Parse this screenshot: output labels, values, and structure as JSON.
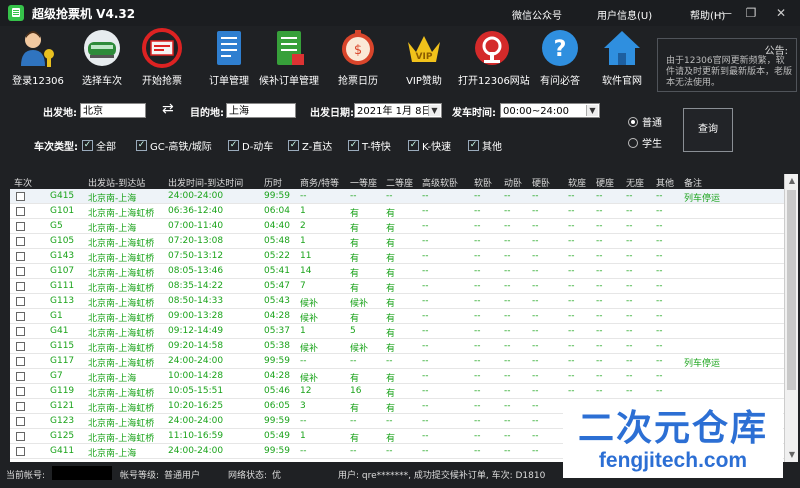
{
  "titlebar": {
    "title": "超级抢票机 V4.32",
    "menu": [
      "微信公众号",
      "用户信息(U)",
      "帮助(H)"
    ],
    "win_buttons": [
      "—",
      "❐",
      "✕"
    ]
  },
  "toolbar": {
    "items": [
      {
        "label": "登录12306",
        "icon": "user-key-icon"
      },
      {
        "label": "选择车次",
        "icon": "train-icon"
      },
      {
        "label": "开始抢票",
        "icon": "ticket-icon"
      },
      {
        "label": "订单管理",
        "icon": "order-list-icon"
      },
      {
        "label": "候补订单管理",
        "icon": "waitlist-icon"
      },
      {
        "label": "抢票日历",
        "icon": "clock-money-icon"
      },
      {
        "label": "VIP赞助",
        "icon": "vip-crown-icon"
      },
      {
        "label": "打开12306网站",
        "icon": "railway-logo-icon"
      },
      {
        "label": "有问必答",
        "icon": "help-icon"
      },
      {
        "label": "软件官网",
        "icon": "home-icon"
      }
    ],
    "notice_title": "公告:",
    "notice_body": "由于12306官网更新频繁，软件请及时更新到最新版本，老版本无法使用。"
  },
  "search": {
    "from_label": "出发地:",
    "from_value": "北京",
    "to_label": "目的地:",
    "to_value": "上海",
    "date_label": "出发日期:",
    "date_value": "2021年 1月 8日",
    "time_label": "发车时间:",
    "time_value": "00:00~24:00",
    "type_label": "车次类型:",
    "types": [
      "全部",
      "GC-高铁/城际",
      "D-动车",
      "Z-直达",
      "T-特快",
      "K-快速",
      "其他"
    ],
    "ticket_types": [
      "普通",
      "学生"
    ],
    "query_label": "查询"
  },
  "table": {
    "headers": [
      "车次",
      "出发站-到达站",
      "出发时间-到达时间",
      "历时",
      "商务/特等",
      "一等座",
      "二等座",
      "高级软卧",
      "软卧",
      "动卧",
      "硬卧",
      "软座",
      "硬座",
      "无座",
      "其他",
      "备注"
    ],
    "rows": [
      [
        "G415",
        "北京南-上海",
        "24:00-24:00",
        "99:59",
        "--",
        "--",
        "--",
        "--",
        "--",
        "--",
        "--",
        "--",
        "--",
        "--",
        "--",
        "列车停运"
      ],
      [
        "G101",
        "北京南-上海虹桥",
        "06:36-12:40",
        "06:04",
        "1",
        "有",
        "有",
        "--",
        "--",
        "--",
        "--",
        "--",
        "--",
        "--",
        "--",
        ""
      ],
      [
        "G5",
        "北京南-上海",
        "07:00-11:40",
        "04:40",
        "2",
        "有",
        "有",
        "--",
        "--",
        "--",
        "--",
        "--",
        "--",
        "--",
        "--",
        ""
      ],
      [
        "G105",
        "北京南-上海虹桥",
        "07:20-13:08",
        "05:48",
        "1",
        "有",
        "有",
        "--",
        "--",
        "--",
        "--",
        "--",
        "--",
        "--",
        "--",
        ""
      ],
      [
        "G143",
        "北京南-上海虹桥",
        "07:50-13:12",
        "05:22",
        "11",
        "有",
        "有",
        "--",
        "--",
        "--",
        "--",
        "--",
        "--",
        "--",
        "--",
        ""
      ],
      [
        "G107",
        "北京南-上海虹桥",
        "08:05-13:46",
        "05:41",
        "14",
        "有",
        "有",
        "--",
        "--",
        "--",
        "--",
        "--",
        "--",
        "--",
        "--",
        ""
      ],
      [
        "G111",
        "北京南-上海虹桥",
        "08:35-14:22",
        "05:47",
        "7",
        "有",
        "有",
        "--",
        "--",
        "--",
        "--",
        "--",
        "--",
        "--",
        "--",
        ""
      ],
      [
        "G113",
        "北京南-上海虹桥",
        "08:50-14:33",
        "05:43",
        "候补",
        "候补",
        "有",
        "--",
        "--",
        "--",
        "--",
        "--",
        "--",
        "--",
        "--",
        ""
      ],
      [
        "G1",
        "北京南-上海虹桥",
        "09:00-13:28",
        "04:28",
        "候补",
        "有",
        "有",
        "--",
        "--",
        "--",
        "--",
        "--",
        "--",
        "--",
        "--",
        ""
      ],
      [
        "G41",
        "北京南-上海虹桥",
        "09:12-14:49",
        "05:37",
        "1",
        "5",
        "有",
        "--",
        "--",
        "--",
        "--",
        "--",
        "--",
        "--",
        "--",
        ""
      ],
      [
        "G115",
        "北京南-上海虹桥",
        "09:20-14:58",
        "05:38",
        "候补",
        "候补",
        "有",
        "--",
        "--",
        "--",
        "--",
        "--",
        "--",
        "--",
        "--",
        ""
      ],
      [
        "G117",
        "北京南-上海虹桥",
        "24:00-24:00",
        "99:59",
        "--",
        "--",
        "--",
        "--",
        "--",
        "--",
        "--",
        "--",
        "--",
        "--",
        "--",
        "列车停运"
      ],
      [
        "G7",
        "北京南-上海",
        "10:00-14:28",
        "04:28",
        "候补",
        "有",
        "有",
        "--",
        "--",
        "--",
        "--",
        "--",
        "--",
        "--",
        "--",
        ""
      ],
      [
        "G119",
        "北京南-上海虹桥",
        "10:05-15:51",
        "05:46",
        "12",
        "16",
        "有",
        "--",
        "--",
        "--",
        "--",
        "--",
        "--",
        "--",
        "--",
        ""
      ],
      [
        "G121",
        "北京南-上海虹桥",
        "10:20-16:25",
        "06:05",
        "3",
        "有",
        "有",
        "--",
        "--",
        "--",
        "--",
        "--",
        "--",
        "--",
        "--",
        ""
      ],
      [
        "G123",
        "北京南-上海虹桥",
        "24:00-24:00",
        "99:59",
        "--",
        "--",
        "--",
        "--",
        "--",
        "--",
        "--",
        "--",
        "--",
        "--",
        "--",
        ""
      ],
      [
        "G125",
        "北京南-上海虹桥",
        "11:10-16:59",
        "05:49",
        "1",
        "有",
        "有",
        "--",
        "--",
        "--",
        "--",
        "--",
        "--",
        "--",
        "--",
        ""
      ],
      [
        "G411",
        "北京南-上海",
        "24:00-24:00",
        "99:59",
        "--",
        "--",
        "--",
        "--",
        "--",
        "--",
        "--",
        "--",
        "--",
        "--",
        "--",
        ""
      ]
    ]
  },
  "status": {
    "account_label": "当前帐号:",
    "level_label": "帐号等级:",
    "level_value": "普通用户",
    "network_label": "网络状态:",
    "network_value": "优",
    "message": "用户: qre*******, 成功提交候补订单, 车次: D1810"
  },
  "watermark": {
    "line1": "二次元仓库",
    "line2": "fengjitech.com"
  },
  "colors": {
    "background": "#1f2124",
    "train_text": "#1aa31a",
    "watermark": "#2c6fd4"
  }
}
